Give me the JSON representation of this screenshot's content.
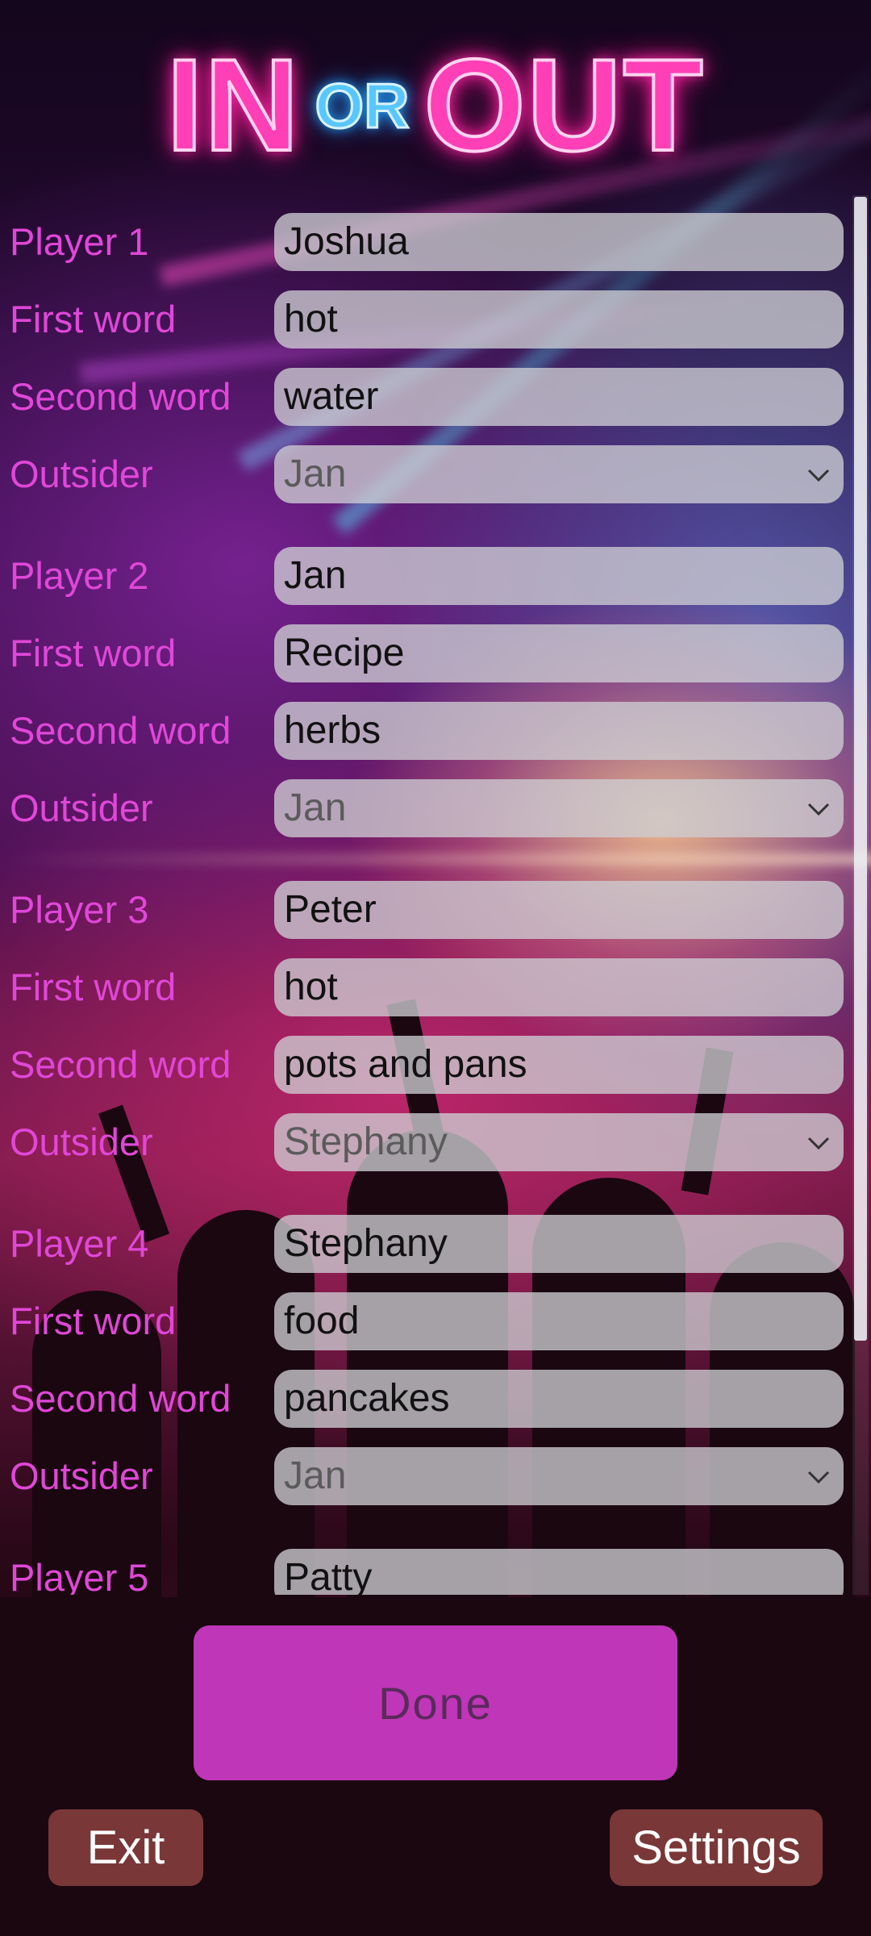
{
  "app": {
    "title_in": "IN",
    "title_or": "OR",
    "title_out": "OUT"
  },
  "labels": {
    "player_prefix": "Player",
    "first_word": "First word",
    "second_word": "Second word",
    "outsider": "Outsider"
  },
  "players": [
    {
      "label": "Player 1",
      "name": "Joshua",
      "first_word": "hot",
      "second_word": "water",
      "outsider": "Jan"
    },
    {
      "label": "Player 2",
      "name": "Jan",
      "first_word": "Recipe",
      "second_word": "herbs",
      "outsider": "Jan"
    },
    {
      "label": "Player 3",
      "name": "Peter",
      "first_word": "hot",
      "second_word": "pots and pans",
      "outsider": "Stephany"
    },
    {
      "label": "Player 4",
      "name": "Stephany",
      "first_word": "food",
      "second_word": "pancakes",
      "outsider": "Jan"
    },
    {
      "label": "Player 5",
      "name": "Patty"
    }
  ],
  "buttons": {
    "done": "Done",
    "exit": "Exit",
    "settings": "Settings"
  },
  "colors": {
    "label": "#e047d8",
    "done_button": "#d63ed0",
    "bottom_button": "#823c3c",
    "title_pink": "#ff3fb6",
    "title_blue": "#58c7ff"
  },
  "icons": {
    "dropdown": "chevron-down-icon"
  }
}
